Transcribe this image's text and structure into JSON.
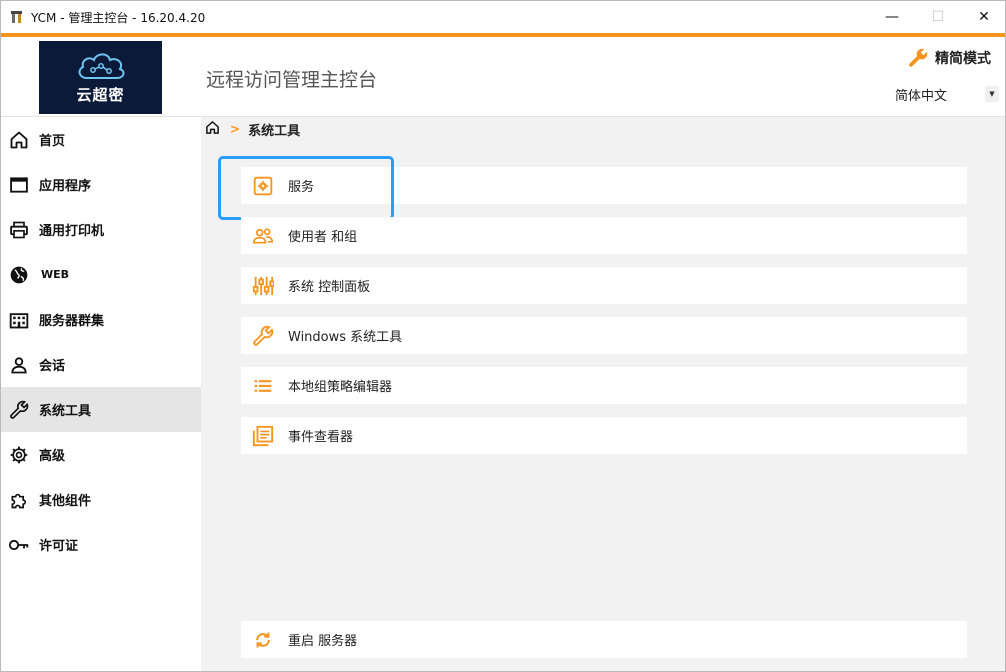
{
  "window": {
    "title": "YCM - 管理主控台 - 16.20.4.20",
    "minimize": "—",
    "maximize": "☐",
    "close": "✕"
  },
  "header": {
    "logo_text": "云超密",
    "app_title": "远程访问管理主控台",
    "mode_label": "精简模式",
    "language": "简体中文",
    "language_arrow": "▼"
  },
  "sidebar": {
    "items": [
      {
        "label": "首页",
        "icon": "home-icon"
      },
      {
        "label": "应用程序",
        "icon": "window-icon"
      },
      {
        "label": "通用打印机",
        "icon": "printer-icon"
      },
      {
        "label": "WEB",
        "icon": "globe-icon"
      },
      {
        "label": "服务器群集",
        "icon": "building-icon"
      },
      {
        "label": "会话",
        "icon": "user-icon"
      },
      {
        "label": "系统工具",
        "icon": "wrench-icon",
        "active": true
      },
      {
        "label": "高级",
        "icon": "gear-icon"
      },
      {
        "label": "其他组件",
        "icon": "puzzle-icon"
      },
      {
        "label": "许可证",
        "icon": "key-icon"
      }
    ]
  },
  "breadcrumb": {
    "separator": ">",
    "current": "系统工具"
  },
  "tools": {
    "items": [
      {
        "label": "服务",
        "icon": "service-icon"
      },
      {
        "label": "使用者 和组",
        "icon": "users-icon"
      },
      {
        "label": "系统 控制面板",
        "icon": "sliders-icon"
      },
      {
        "label": "Windows 系统工具",
        "icon": "wrench-icon"
      },
      {
        "label": "本地组策略编辑器",
        "icon": "list-icon"
      },
      {
        "label": "事件查看器",
        "icon": "event-viewer-icon"
      }
    ],
    "restart_label": "重启 服务器"
  },
  "colors": {
    "accent": "#f7941d",
    "highlight_border": "#2a9df4",
    "logo_bg": "#0c1a3a",
    "active_bg": "#e5e5e5"
  }
}
